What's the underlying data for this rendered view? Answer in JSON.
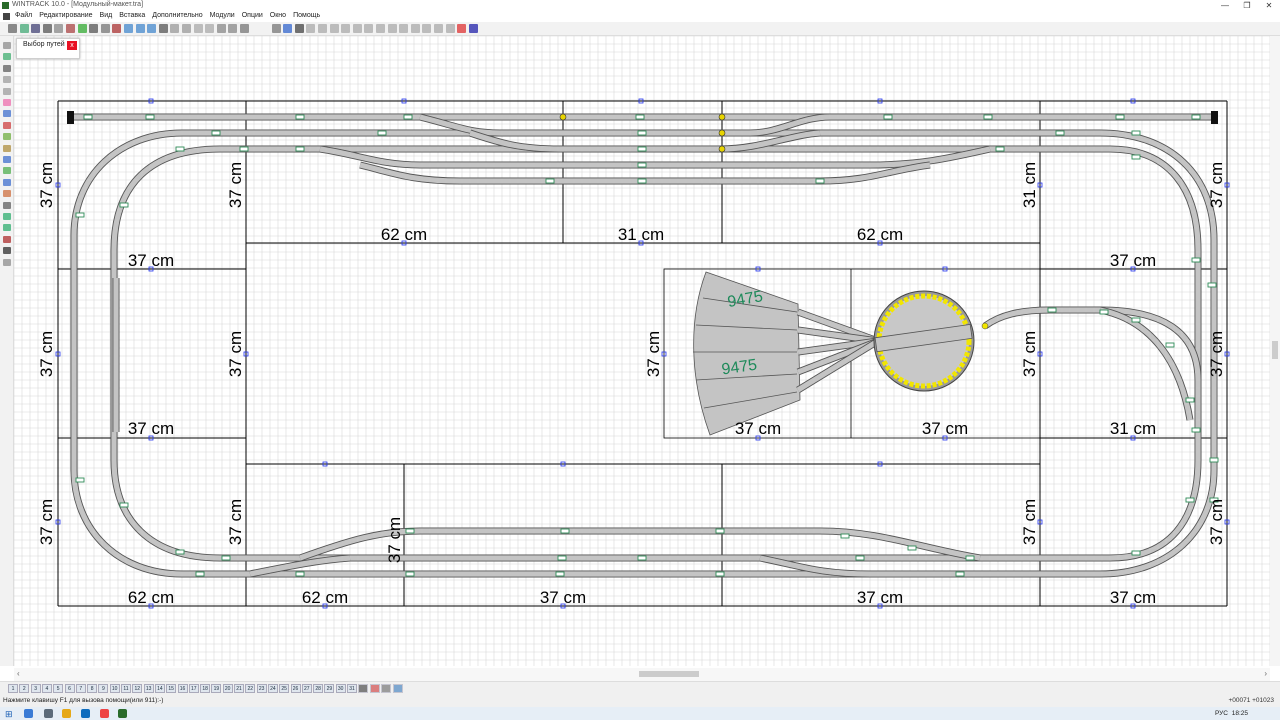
{
  "window": {
    "title": "WINTRACK 10.0 - [Модульный-макет.tra]",
    "minimize": "—",
    "maximize": "❐",
    "close": "✕"
  },
  "menu": [
    "Файл",
    "Редактирование",
    "Вид",
    "Вставка",
    "Дополнительно",
    "Модули",
    "Опции",
    "Окно",
    "Помощь"
  ],
  "panel": {
    "title": "Выбор путей",
    "close": "x"
  },
  "layout": {
    "grid_module_labels": [
      {
        "text": "62 cm"
      },
      {
        "text": "31 cm"
      },
      {
        "text": "62 cm"
      },
      {
        "text": "37 cm"
      },
      {
        "text": "37 cm"
      },
      {
        "text": "37 cm"
      },
      {
        "text": "37 cm"
      },
      {
        "text": "37 cm"
      },
      {
        "text": "31 cm"
      },
      {
        "text": "62 cm"
      },
      {
        "text": "62 cm"
      },
      {
        "text": "37 cm"
      },
      {
        "text": "37 cm"
      },
      {
        "text": "37 cm"
      }
    ],
    "vertical_labels": [
      "37 cm",
      "37 cm",
      "37 cm",
      "37 cm",
      "37 cm",
      "37 cm",
      "37 cm",
      "31 cm",
      "37 cm",
      "37 cm",
      "37 cm",
      "37 cm",
      "37 cm",
      "37 cm"
    ],
    "part_numbers": [
      "9475",
      "9475"
    ]
  },
  "status": {
    "hint": "Нажмите клавишу F1 для вызова помощи(или 911):-)",
    "coords": "+00071  +01023"
  },
  "taskbar": {
    "lang": "РУС",
    "time": "18:25"
  },
  "colors": {
    "track": "#c4c4c4",
    "track_edge": "#555555",
    "joint": "#2e8b57",
    "turntable_ring": "#f2e600",
    "grid": "#d8d8d8",
    "module_border": "#000000",
    "part_number": "#1e8a5a"
  }
}
